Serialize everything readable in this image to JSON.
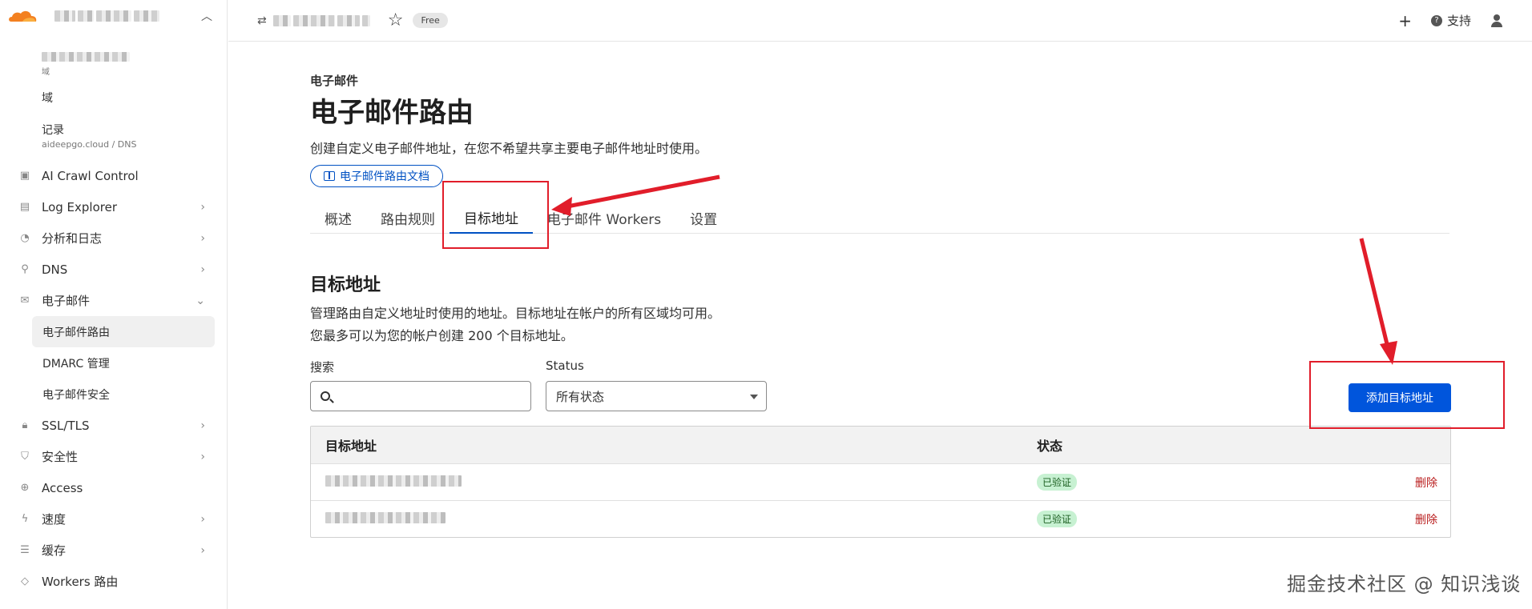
{
  "sidebar": {
    "domain_label": "域",
    "domain_caption": "域",
    "records_label": "记录",
    "records_caption": "aideepgo.cloud / DNS",
    "items": [
      {
        "label": "AI Crawl Control",
        "icon": "bot-icon",
        "has_chevron": false
      },
      {
        "label": "Log Explorer",
        "icon": "log-icon",
        "has_chevron": true
      },
      {
        "label": "分析和日志",
        "icon": "analytics-icon",
        "has_chevron": true
      },
      {
        "label": "DNS",
        "icon": "dns-icon",
        "has_chevron": true
      },
      {
        "label": "电子邮件",
        "icon": "mail-icon",
        "has_chevron": true,
        "expanded": true
      }
    ],
    "email_children": [
      {
        "label": "电子邮件路由",
        "active": true
      },
      {
        "label": "DMARC 管理",
        "active": false
      },
      {
        "label": "电子邮件安全",
        "active": false
      }
    ],
    "items_after": [
      {
        "label": "SSL/TLS",
        "icon": "lock-icon",
        "has_chevron": true
      },
      {
        "label": "安全性",
        "icon": "shield-icon",
        "has_chevron": true
      },
      {
        "label": "Access",
        "icon": "access-icon",
        "has_chevron": false
      },
      {
        "label": "速度",
        "icon": "bolt-icon",
        "has_chevron": true
      },
      {
        "label": "缓存",
        "icon": "cache-icon",
        "has_chevron": true
      },
      {
        "label": "Workers 路由",
        "icon": "workers-icon",
        "has_chevron": false
      }
    ]
  },
  "topbar": {
    "plan_badge": "Free",
    "support_label": "支持"
  },
  "main": {
    "eyebrow": "电子邮件",
    "title": "电子邮件路由",
    "description": "创建自定义电子邮件地址，在您不希望共享主要电子邮件地址时使用。",
    "docs_link": "电子邮件路由文档",
    "tabs": [
      {
        "label": "概述",
        "active": false
      },
      {
        "label": "路由规则",
        "active": false
      },
      {
        "label": "目标地址",
        "active": true
      },
      {
        "label": "电子邮件 Workers",
        "active": false
      },
      {
        "label": "设置",
        "active": false
      }
    ],
    "section_title": "目标地址",
    "section_desc_1": "管理路由自定义地址时使用的地址。目标地址在帐户的所有区域均可用。",
    "section_desc_2": "您最多可以为您的帐户创建 200 个目标地址。",
    "search_label": "搜索",
    "search_value": "",
    "status_label": "Status",
    "status_value": "所有状态",
    "add_button": "添加目标地址",
    "table": {
      "headers": [
        "目标地址",
        "状态"
      ],
      "rows": [
        {
          "status": "已验证",
          "action": "删除"
        },
        {
          "status": "已验证",
          "action": "删除"
        }
      ]
    }
  },
  "watermark": "掘金技术社区 @ 知识浅谈",
  "colors": {
    "accent": "#0055dc",
    "annotation": "#e11d2a",
    "verified_bg": "#c7f1d2",
    "delete": "#b91c1c"
  }
}
